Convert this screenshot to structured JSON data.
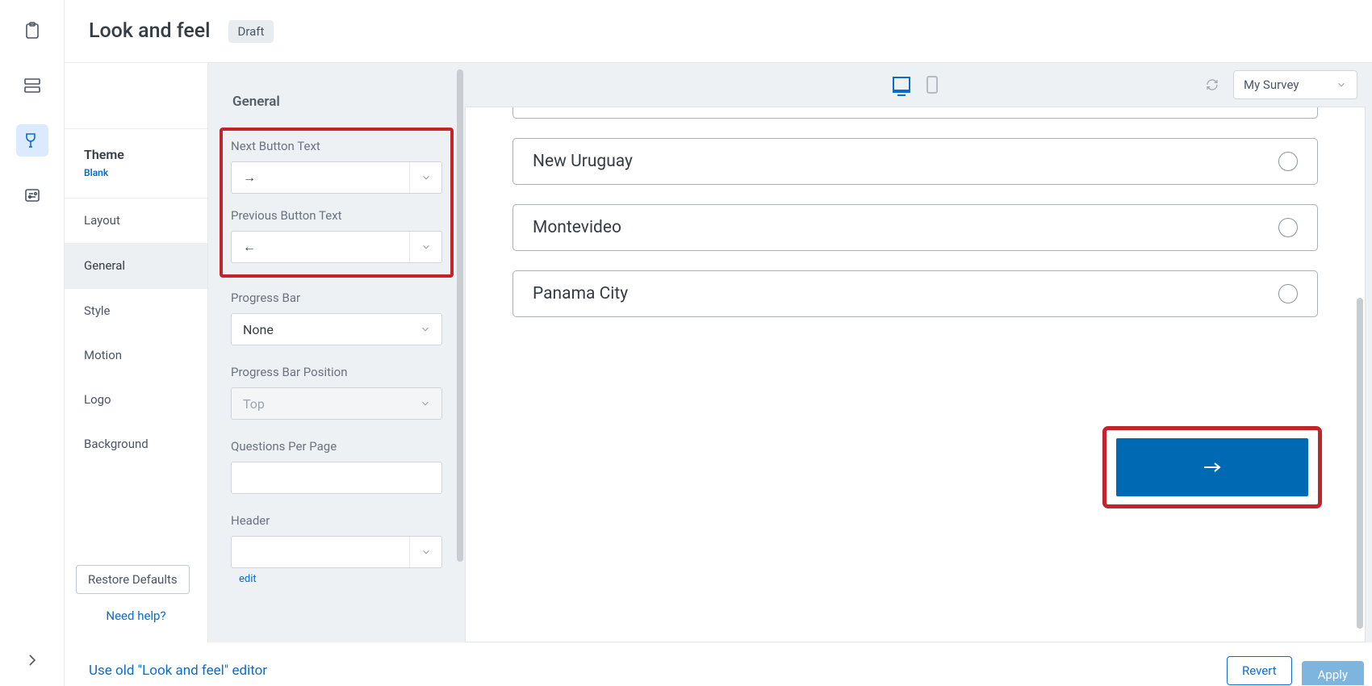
{
  "header": {
    "title": "Look and feel",
    "status_badge": "Draft"
  },
  "sidebar": {
    "theme_label": "Theme",
    "theme_name": "Blank",
    "items": [
      {
        "label": "Layout"
      },
      {
        "label": "General"
      },
      {
        "label": "Style"
      },
      {
        "label": "Motion"
      },
      {
        "label": "Logo"
      },
      {
        "label": "Background"
      }
    ],
    "selected_index": 1,
    "restore_defaults": "Restore Defaults",
    "need_help": "Need help?"
  },
  "settings": {
    "heading": "General",
    "next_button_text_label": "Next Button Text",
    "next_button_text_value": "→",
    "previous_button_text_label": "Previous Button Text",
    "previous_button_text_value": "←",
    "progress_bar_label": "Progress Bar",
    "progress_bar_value": "None",
    "progress_bar_position_label": "Progress Bar Position",
    "progress_bar_position_value": "Top",
    "questions_per_page_label": "Questions Per Page",
    "questions_per_page_value": "",
    "header_label": "Header",
    "header_value": "",
    "edit_link": "edit"
  },
  "preview": {
    "survey_selector": "My Survey",
    "options": [
      {
        "label": "New Uruguay"
      },
      {
        "label": "Montevideo"
      },
      {
        "label": "Panama City"
      }
    ],
    "next_button": "→"
  },
  "footer": {
    "old_editor_link": "Use old \"Look and feel\" editor",
    "revert": "Revert",
    "apply": "Apply"
  }
}
